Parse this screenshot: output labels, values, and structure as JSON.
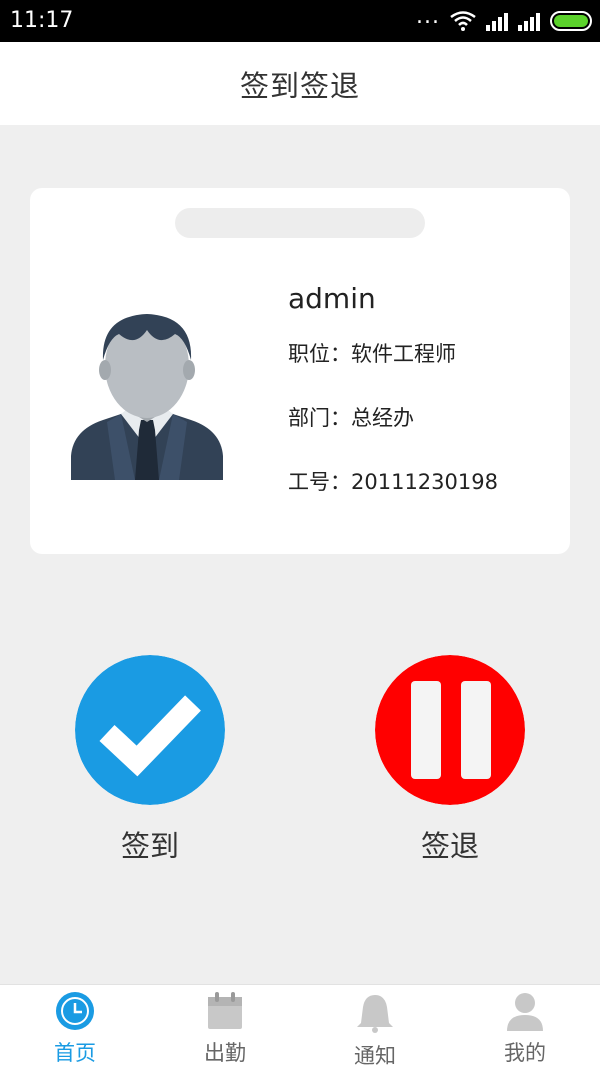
{
  "status_bar": {
    "time": "11:17",
    "dots": "...",
    "battery_color": "#5bd22b"
  },
  "header": {
    "title": "签到签退"
  },
  "profile": {
    "name": "admin",
    "position_label": "职位：",
    "position_value": "软件工程师",
    "department_label": "部门：",
    "department_value": "总经办",
    "employee_id_label": "工号：",
    "employee_id_value": "20111230198"
  },
  "actions": {
    "sign_in": {
      "label": "签到",
      "color": "#1a9be3",
      "icon": "checkmark-icon"
    },
    "sign_out": {
      "label": "签退",
      "color": "#ff0000",
      "icon": "pause-icon"
    }
  },
  "bottom_nav": {
    "active_color": "#1a9be3",
    "items": [
      {
        "label": "首页",
        "icon": "clock-icon",
        "active": true
      },
      {
        "label": "出勤",
        "icon": "calendar-icon",
        "active": false
      },
      {
        "label": "通知",
        "icon": "bell-icon",
        "active": false
      },
      {
        "label": "我的",
        "icon": "person-icon",
        "active": false
      }
    ]
  }
}
